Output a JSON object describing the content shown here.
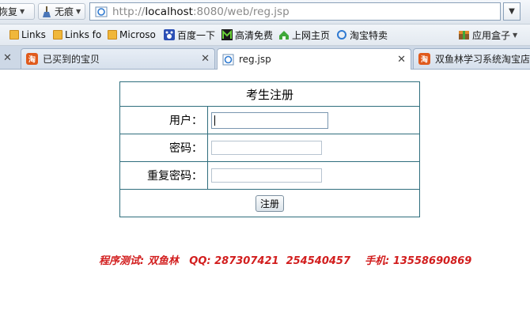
{
  "toolbar": {
    "history_label": "恢复",
    "trace_label": "无痕",
    "url_prefix": "http://",
    "url_host": "localhost",
    "url_rest": ":8080/web/reg.jsp"
  },
  "bookmarks": {
    "items": [
      {
        "label": "Links"
      },
      {
        "label": "Links fo"
      },
      {
        "label": "Microso"
      },
      {
        "label": "百度一下"
      },
      {
        "label": "高清免费"
      },
      {
        "label": "上网主页"
      },
      {
        "label": "淘宝特卖"
      }
    ],
    "app_box_label": "应用盒子"
  },
  "tabs": [
    {
      "label": "已买到的宝贝",
      "icon": "taobao-icon",
      "active": false
    },
    {
      "label": "reg.jsp",
      "icon": "ie-page-icon",
      "active": true
    },
    {
      "label": "双鱼林学习系统淘宝店 -",
      "icon": "taobao-icon",
      "active": false
    }
  ],
  "form": {
    "title": "考生注册",
    "user_label": "用户：",
    "password_label": "密码：",
    "confirm_label": "重复密码：",
    "submit_label": "注册"
  },
  "footer": {
    "text": "程序测试: 双鱼林   QQ: 287307421  254540457    手机: 13558690869"
  },
  "colors": {
    "table_border": "#2f6e7d",
    "footer_text": "#d21e1e"
  }
}
